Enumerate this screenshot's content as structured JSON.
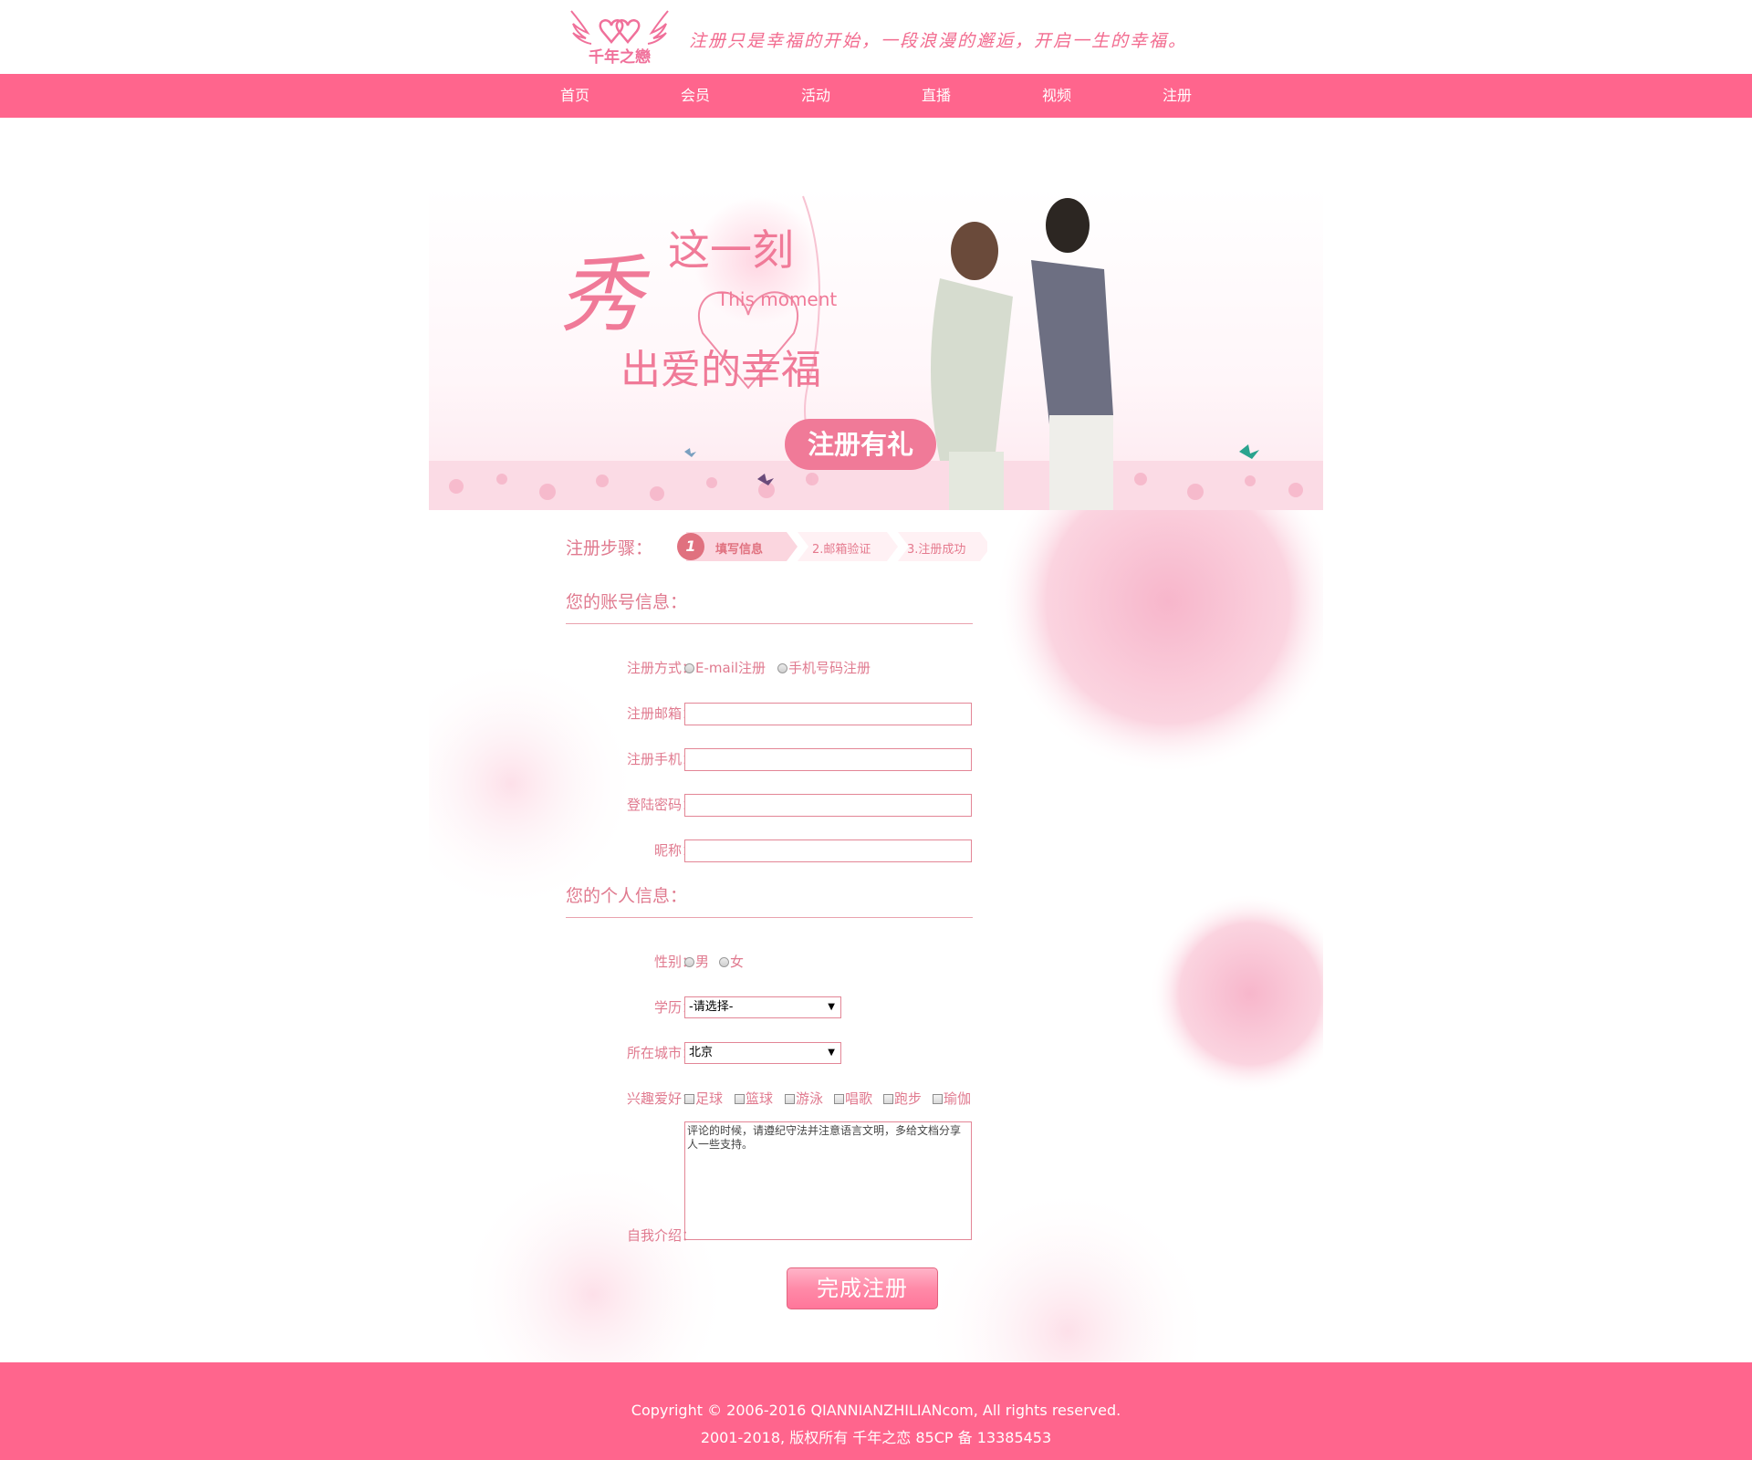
{
  "header": {
    "logo_text": "千年之戀",
    "slogan": "注册只是幸福的开始，一段浪漫的邂逅，开启一生的幸福。"
  },
  "nav": {
    "items": [
      {
        "label": "首页"
      },
      {
        "label": "会员"
      },
      {
        "label": "活动"
      },
      {
        "label": "直播"
      },
      {
        "label": "视频"
      },
      {
        "label": "注册"
      }
    ]
  },
  "banner": {
    "big_char": "秀",
    "line1": "这一刻",
    "line1_en": "This moment",
    "line2": "出爱的幸福",
    "badge": "注册有礼"
  },
  "steps": {
    "label": "注册步骤：",
    "step1_num": "1",
    "step1": "填写信息",
    "step2": "2.邮箱验证",
    "step3": "3.注册成功"
  },
  "account": {
    "title": "您的账号信息：",
    "method_label": "注册方式：",
    "method_options": [
      "E-mail注册",
      "手机号码注册"
    ],
    "email_label": "注册邮箱：",
    "phone_label": "注册手机：",
    "password_label": "登陆密码：",
    "nickname_label": "昵称："
  },
  "personal": {
    "title": "您的个人信息：",
    "gender_label": "性别：",
    "gender_options": [
      "男",
      "女"
    ],
    "education_label": "学历：",
    "education_value": "-请选择-",
    "city_label": "所在城市：",
    "city_value": "北京",
    "hobby_label": "兴趣爱好：",
    "hobbies": [
      "足球",
      "篮球",
      "游泳",
      "唱歌",
      "跑步",
      "瑜伽"
    ],
    "intro_label": "自我介绍：",
    "intro_text": "评论的时候，请遵纪守法并注意语言文明，多给文档分享人一些支持。"
  },
  "submit_label": "完成注册",
  "footer": {
    "line1": "Copyright © 2006-2016 QIANNIANZHILIANcom, All rights reserved.",
    "line2": "2001-2018, 版权所有 千年之恋 85CP 备 13385453"
  },
  "colors": {
    "brand_pink": "#ff658d",
    "label_pink": "#e07a8f",
    "border_pink": "#e38696"
  }
}
